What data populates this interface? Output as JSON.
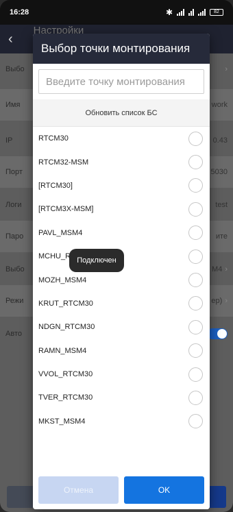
{
  "status_bar": {
    "time": "16:28",
    "battery": "82"
  },
  "background_app": {
    "header_title": "Настройки",
    "rows": [
      {
        "label": "Выбо",
        "value": "",
        "chevron": true
      },
      {
        "label": "Имя",
        "value": "work",
        "chevron": false
      },
      {
        "label": "IP",
        "value": "0.43",
        "chevron": false
      },
      {
        "label": "Порт",
        "value": "5030",
        "chevron": false
      },
      {
        "label": "Логи",
        "value": "test",
        "chevron": false
      },
      {
        "label": "Паро",
        "value": "ите",
        "chevron": false
      },
      {
        "label": "Выбо",
        "value": "M4",
        "chevron": true
      },
      {
        "label": "Режи",
        "value": "ep)",
        "chevron": true
      },
      {
        "label": "Авто",
        "value": "",
        "toggle": true
      }
    ]
  },
  "dialog": {
    "title": "Выбор точки монтирования",
    "search_placeholder": "Введите точку монтирования",
    "refresh_label": "Обновить список БС",
    "items": [
      "RTCM30",
      "RTCM32-MSM",
      "[RTCM30]",
      "[RTCM3X-MSM]",
      "PAVL_MSM4",
      "MCHU_RTCM30",
      "MOZH_MSM4",
      "KRUT_RTCM30",
      "NDGN_RTCM30",
      "RAMN_MSM4",
      "VVOL_RTCM30",
      "TVER_RTCM30",
      "MKST_MSM4"
    ],
    "cancel_label": "Отмена",
    "ok_label": "OK"
  },
  "toast": {
    "text": "Подключен"
  },
  "colors": {
    "dialog_header": "#262a3a",
    "ok_button": "#1474e0",
    "cancel_button": "#c7d6f2",
    "toggle": "#1c5fc0"
  }
}
